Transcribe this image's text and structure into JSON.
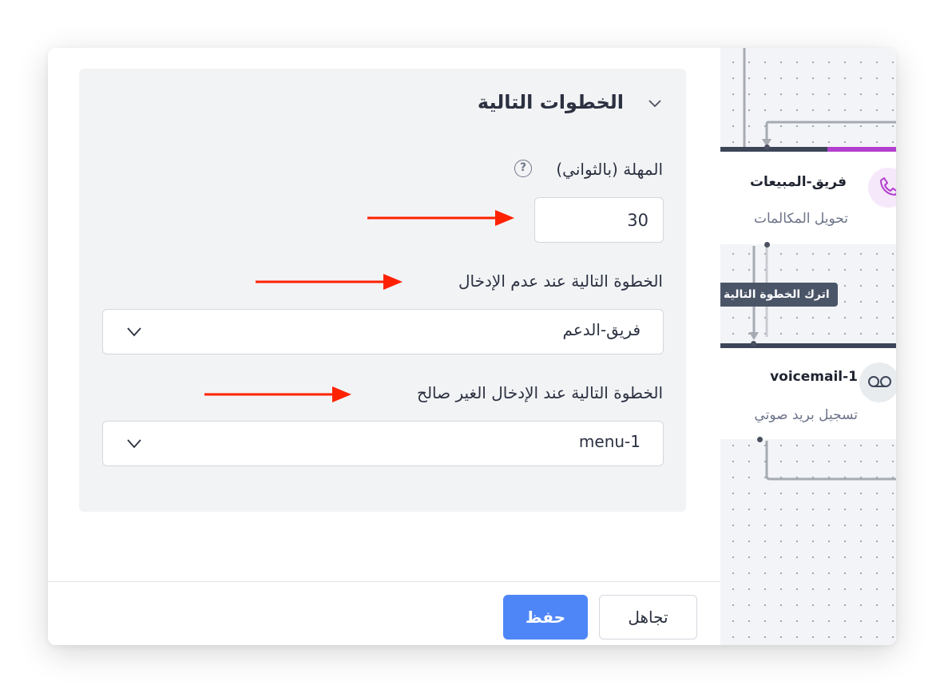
{
  "panel": {
    "section_title": "الخطوات التالية",
    "timeout": {
      "label": "المهلة (بالثواني)",
      "help_glyph": "?",
      "value": "30"
    },
    "no_input": {
      "label": "الخطوة التالية عند عدم الإدخال",
      "selected": "فريق-الدعم"
    },
    "invalid_input": {
      "label": "الخطوة التالية عند الإدخال الغير صالح",
      "selected": "menu-1"
    },
    "footer": {
      "save_label": "حفظ",
      "cancel_label": "تجاهل"
    }
  },
  "canvas": {
    "nodes": [
      {
        "title": "فريق-المبيعات",
        "subtitle": "تحويل المكالمات",
        "icon": "phone-icon",
        "accent": "#b23fce"
      },
      {
        "title": "voicemail-1",
        "subtitle": "تسجيل بريد صوتي",
        "icon": "voicemail-icon",
        "accent": "#3b4557"
      }
    ],
    "edge_label": "اترك الخطوة التالية"
  },
  "colors": {
    "primary": "#4f86f7",
    "annotation_arrow": "#ff2200",
    "accent_purple": "#b23fce",
    "accent_dark": "#3b4557"
  }
}
